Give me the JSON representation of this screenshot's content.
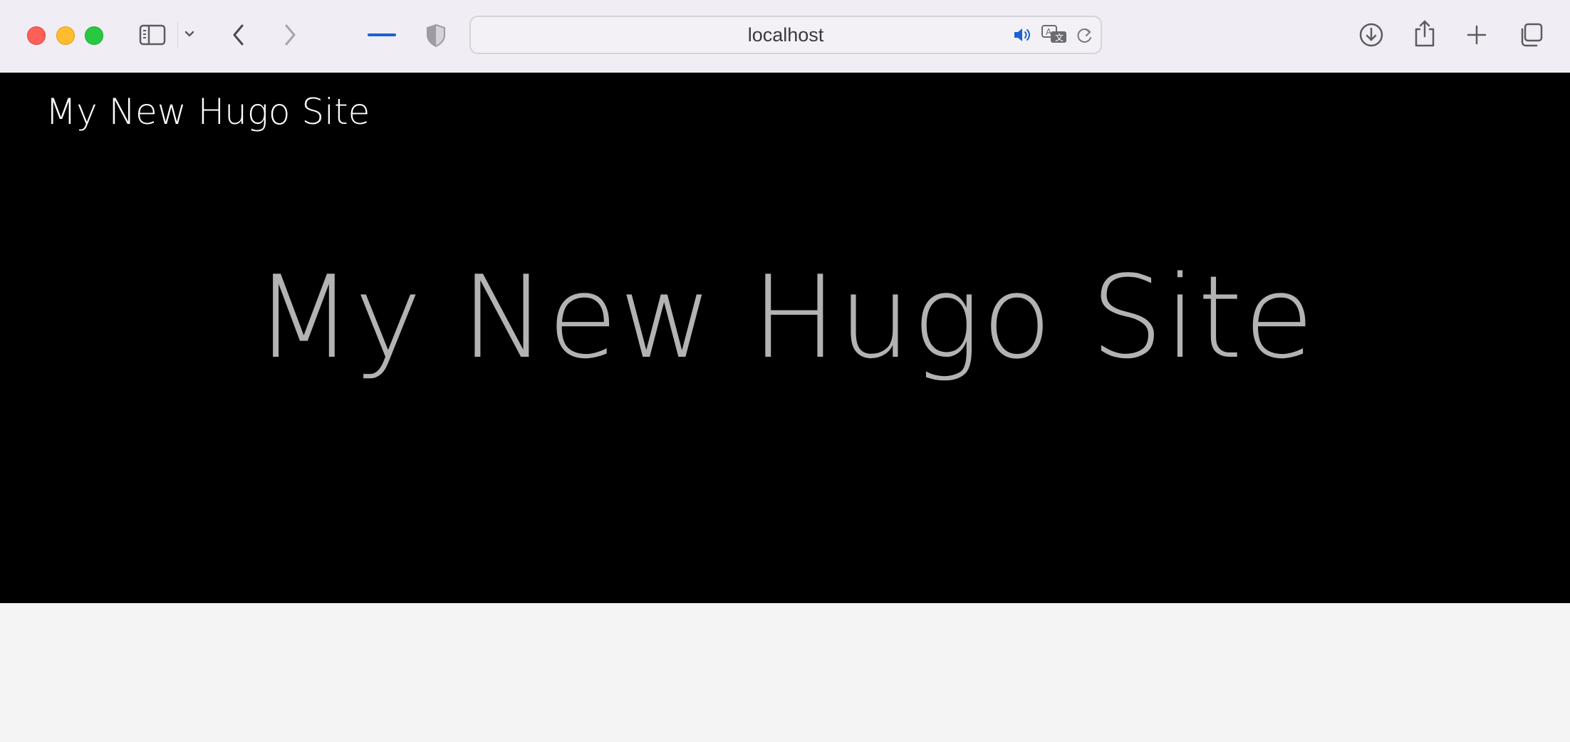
{
  "browser": {
    "address": "localhost",
    "icons": {
      "sidebar": "sidebar-icon",
      "sidebar_menu": "chevron-down-icon",
      "back": "chevron-left-icon",
      "forward": "chevron-right-icon",
      "tab_indicator": "tab-indicator-icon",
      "privacy": "shield-icon",
      "audio": "speaker-icon",
      "translate": "translate-icon",
      "reload": "reload-icon",
      "downloads": "download-icon",
      "share": "share-icon",
      "new_tab": "plus-icon",
      "tab_overview": "tabs-icon"
    },
    "colors": {
      "toolbar": "#f0edf4",
      "accent": "#1a62d6",
      "close": "#fe5f57",
      "minimize": "#febc2e",
      "zoom": "#28c840"
    }
  },
  "page": {
    "brand": "My New Hugo Site",
    "hero_title": "My New Hugo Site",
    "colors": {
      "hero_bg": "#000000",
      "brand_text": "#ffffff",
      "hero_text": "#b3b3b3",
      "page_bg": "#f4f4f4"
    }
  }
}
